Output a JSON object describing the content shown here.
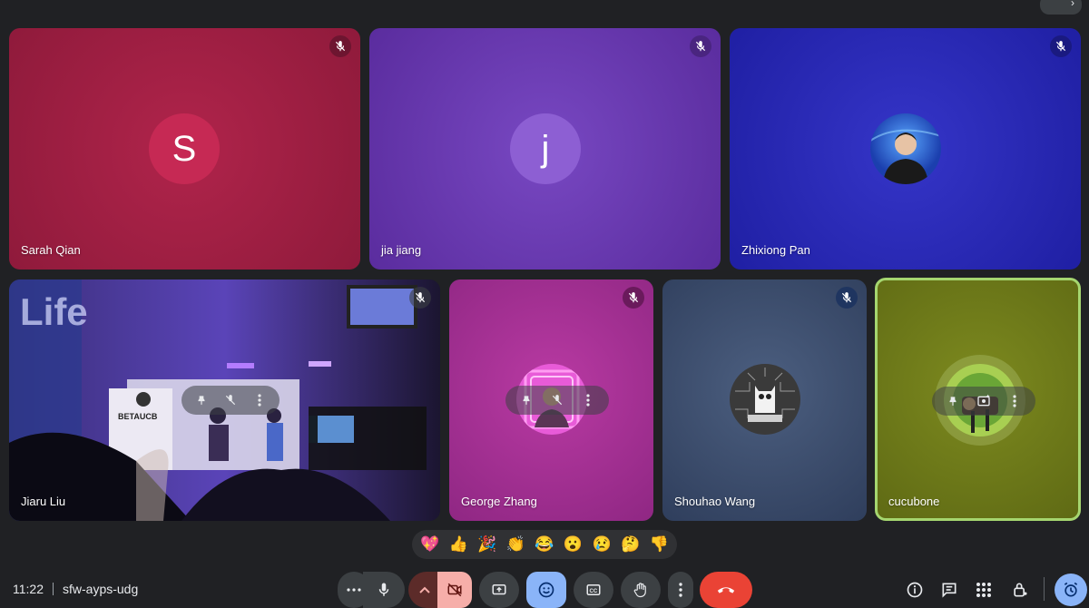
{
  "meeting": {
    "time": "11:22",
    "code": "sfw-ayps-udg"
  },
  "participants": [
    {
      "name": "Sarah Qian",
      "initial": "S",
      "color": "#a01c41"
    },
    {
      "name": "jia jiang",
      "initial": "j",
      "color": "#6a34b0"
    },
    {
      "name": "Zhixiong Pan",
      "color": "#2b2bb8"
    },
    {
      "name": "Jiaru Liu",
      "stage_text": "BETAUCB"
    },
    {
      "name": "George Zhang",
      "color": "#a4308f"
    },
    {
      "name": "Shouhao Wang",
      "color": "#3c4e6e"
    },
    {
      "name": "cucubone",
      "color": "#6f7b1a"
    }
  ],
  "reactions": [
    "💖",
    "👍",
    "🎉",
    "👏",
    "😂",
    "😮",
    "😢",
    "🤔",
    "👎"
  ],
  "colors": {
    "end_call": "#ea4335",
    "active_blue": "#8ab4f8",
    "camera_off_bg": "#f6aea9",
    "speaking_border": "#a5d66f"
  }
}
